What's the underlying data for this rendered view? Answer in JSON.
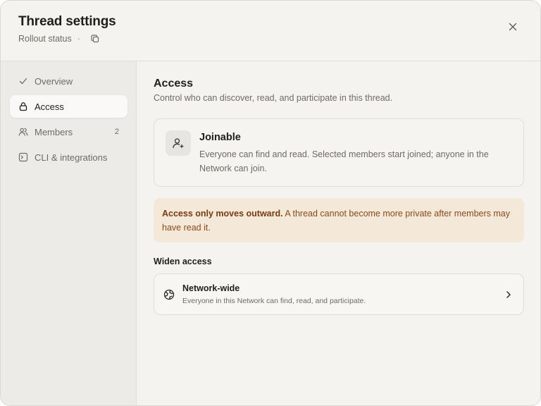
{
  "header": {
    "title": "Thread settings",
    "subtitle": "Rollout status",
    "separator": "·",
    "copy_icon": "copy-icon",
    "close_icon": "close-icon"
  },
  "sidebar": {
    "items": [
      {
        "label": "Overview",
        "icon": "check-icon",
        "active": false
      },
      {
        "label": "Access",
        "icon": "lock-icon",
        "active": true
      },
      {
        "label": "Members",
        "icon": "users-icon",
        "active": false,
        "count": "2"
      },
      {
        "label": "CLI & integrations",
        "icon": "terminal-icon",
        "active": false
      }
    ]
  },
  "main": {
    "title": "Access",
    "description": "Control who can discover, read, and participate in this thread.",
    "joinable": {
      "title": "Joinable",
      "description": "Everyone can find and read. Selected members start joined; anyone in the Network can join.",
      "icon": "user-plus-icon"
    },
    "warning": {
      "bold": "Access only moves outward.",
      "text": " A thread cannot become more private after members may have read it."
    },
    "widen_label": "Widen access",
    "network": {
      "title": "Network-wide",
      "description": "Everyone in this Network can find, read, and participate.",
      "icon": "globe-icon",
      "chevron_icon": "chevron-right-icon"
    }
  },
  "colors": {
    "background": "#f5f3ef",
    "sidebar": "#ecebe8",
    "warning_bg": "#f4e8d8",
    "warning_text": "#8a4a1c"
  }
}
